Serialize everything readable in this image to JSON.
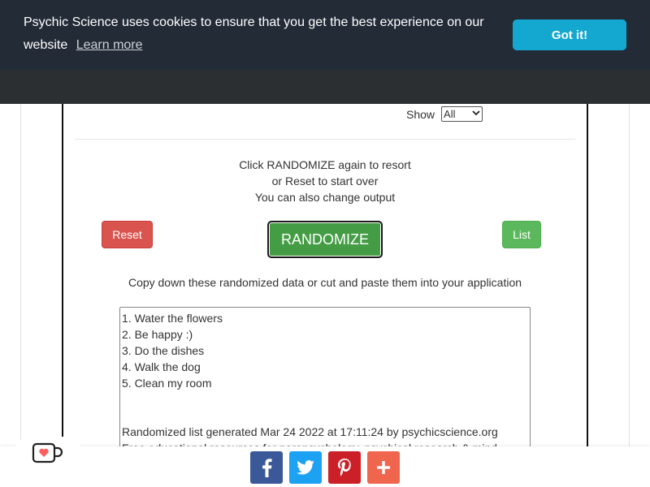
{
  "cookie_banner": {
    "message": "Psychic Science uses cookies to ensure that you get the best experience on our website",
    "learn_more": "Learn more",
    "accept_label": "Got it!"
  },
  "filter": {
    "label": "Show",
    "selected": "All"
  },
  "instructions": [
    "Click RANDOMIZE again to resort",
    "or Reset to start over",
    "You can also change output"
  ],
  "buttons": {
    "reset": "Reset",
    "randomize": "RANDOMIZE",
    "list": "List"
  },
  "copy_hint": "Copy down these randomized data or cut and paste them into your application",
  "output": {
    "items": [
      "1. Water the flowers",
      "2. Be happy :)",
      "3. Do the dishes",
      "4. Walk the dog",
      "5. Clean my room"
    ],
    "generated": "Randomized list generated Mar 24 2022 at 17:11:24 by psychicscience.org",
    "footer": "Free educational resources for parapsychology, psychical research & mind"
  },
  "share": {
    "icons": [
      "facebook-icon",
      "twitter-icon",
      "pinterest-icon",
      "plus-icon"
    ]
  },
  "colors": {
    "banner_bg": "#232b37",
    "accept_bg": "#14a7d0",
    "reset_bg": "#d9534f",
    "randomize_bg": "#449d44",
    "list_bg": "#5cb85c",
    "facebook": "#3b5998",
    "twitter": "#1da1f2",
    "pinterest": "#cb2027",
    "more": "#f0654d"
  }
}
